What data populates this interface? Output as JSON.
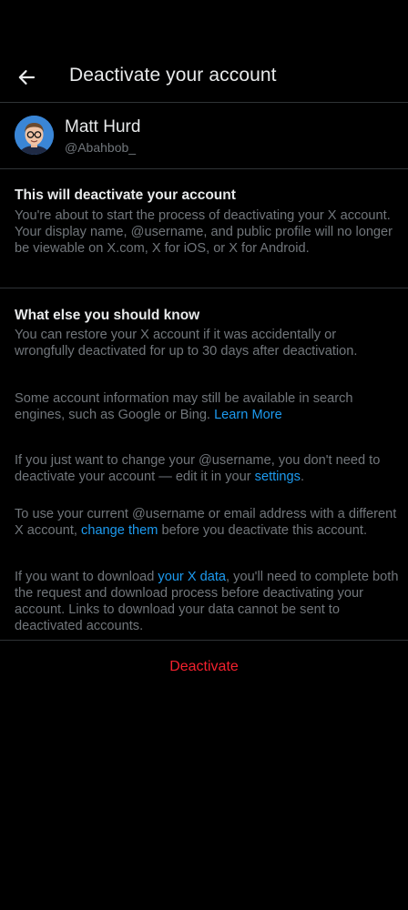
{
  "header": {
    "title": "Deactivate your account"
  },
  "profile": {
    "name": "Matt Hurd",
    "handle": "@Abahbob_"
  },
  "section1": {
    "title": "This will deactivate your account",
    "body": "You're about to start the process of deactivating your X account. Your display name, @username, and public profile will no longer be viewable on X.com, X for iOS, or X for Android."
  },
  "section2": {
    "title": "What else you should know",
    "p1": "You can restore your X account if it was accidentally or wrongfully deactivated for up to 30 days after deactivation.",
    "p2_text": "Some account information may still be available in search engines, such as Google or Bing.",
    "p2_link": "Learn More",
    "p3_text": "If you just want to change your @username, you don't need to deactivate your account — edit it in your",
    "p3_link": "settings",
    "p3_end": ".",
    "p4_text1": "To use your current @username or email address with a different X account,",
    "p4_link": "change them",
    "p4_text2": "before you deactivate this account.",
    "p5_text1": "If you want to download",
    "p5_link": "your X data",
    "p5_text2": ", you'll need to complete both the request and download process before deactivating your account. Links to download your data cannot be sent to deactivated accounts."
  },
  "actions": {
    "deactivate_label": "Deactivate"
  },
  "colors": {
    "background": "#000000",
    "primary_text": "#e7e9ea",
    "secondary_text": "#71767b",
    "link": "#1d9bf0",
    "danger": "#f4212e",
    "divider": "#2f3336"
  }
}
